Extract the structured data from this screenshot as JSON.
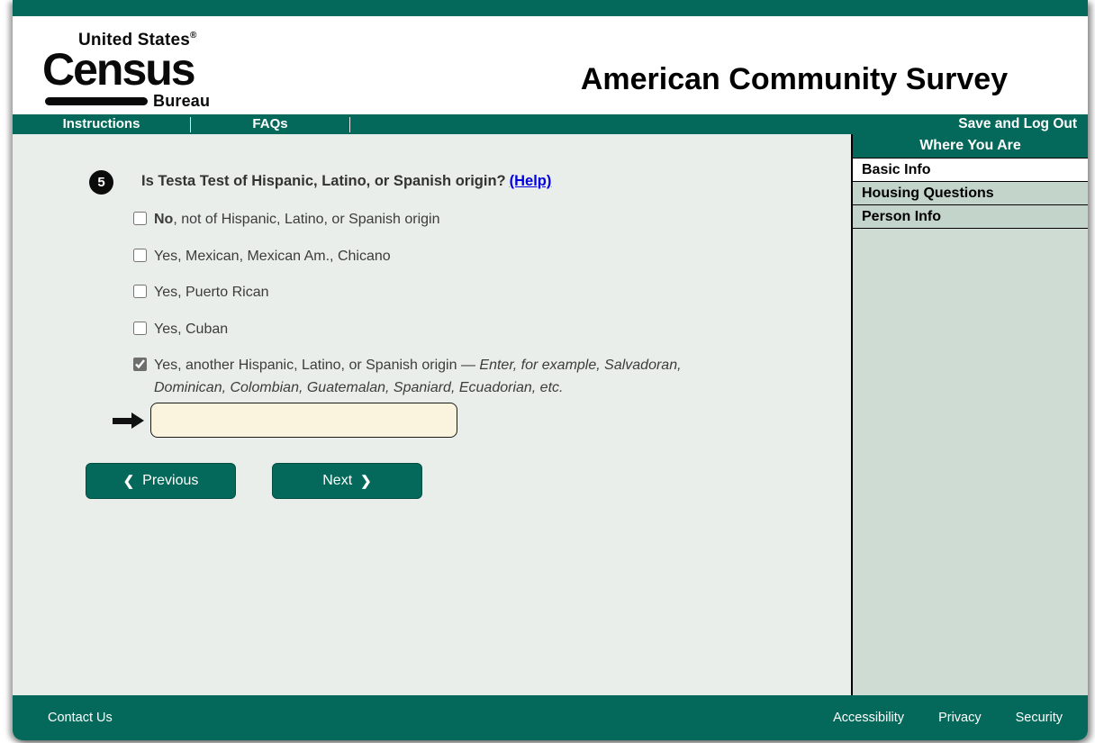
{
  "theme": {
    "dark_green": "#04695a",
    "content_bg": "#e9eeeb",
    "sidebar_bg": "#cfdcd3",
    "sidebar_item_bg": "#c3d5ca",
    "input_bg": "#faf3dd",
    "link_blue": "#0000e0"
  },
  "header": {
    "logo": {
      "line1": "United States",
      "reg_mark": "®",
      "line2": "Census",
      "line3": "Bureau"
    },
    "title": "American Community Survey"
  },
  "nav": {
    "items": [
      {
        "label": "Instructions"
      },
      {
        "label": "FAQs"
      }
    ],
    "right_label": "Save and Log Out"
  },
  "sidebar": {
    "title": "Where You Are",
    "items": [
      {
        "label": "Basic Info",
        "active": true
      },
      {
        "label": "Housing Questions",
        "active": false
      },
      {
        "label": "Person Info",
        "active": false
      }
    ]
  },
  "question": {
    "number": "5",
    "text": "Is Testa Test of Hispanic, Latino, or Spanish origin?",
    "help_label": "(Help)",
    "options": [
      {
        "bold": "No",
        "text": ", not of Hispanic, Latino, or Spanish origin",
        "checked": false
      },
      {
        "text": "Yes, Mexican, Mexican Am., Chicano",
        "checked": false
      },
      {
        "text": "Yes, Puerto Rican",
        "checked": false
      },
      {
        "text": "Yes, Cuban",
        "checked": false
      },
      {
        "text": "Yes, another Hispanic, Latino, or Spanish origin — ",
        "italic": "Enter, for example, Salvadoran, Dominican, Colombian, Guatemalan, Spaniard, Ecuadorian, etc.",
        "checked": true
      }
    ],
    "answer_input": {
      "value": ""
    }
  },
  "buttons": {
    "previous": {
      "label": "Previous",
      "icon": "❮"
    },
    "next": {
      "label": "Next",
      "icon": "❯"
    }
  },
  "footer": {
    "left_links": [
      {
        "label": "Contact Us"
      }
    ],
    "right_links": [
      {
        "label": "Accessibility"
      },
      {
        "label": "Privacy"
      },
      {
        "label": "Security"
      }
    ]
  }
}
